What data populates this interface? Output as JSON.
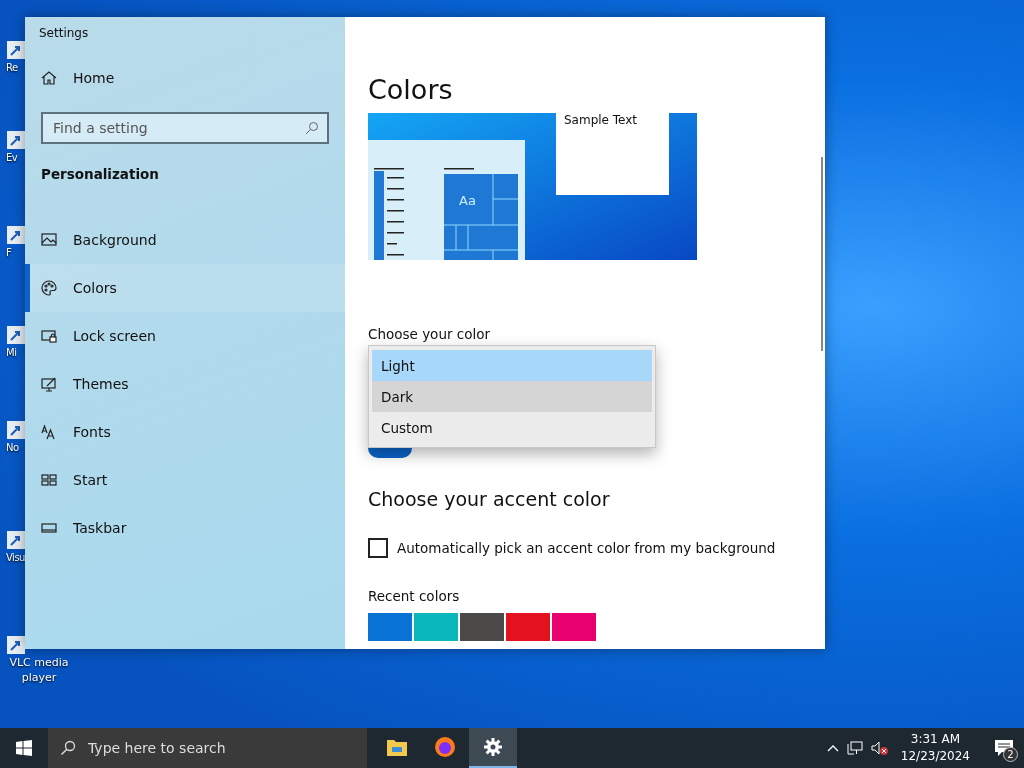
{
  "desktop_icons": [
    {
      "label": "Re"
    },
    {
      "label": "Ev"
    },
    {
      "label": "F"
    },
    {
      "label": "Mi"
    },
    {
      "label": "No"
    },
    {
      "label": "Visu"
    },
    {
      "label": "VLC media player"
    }
  ],
  "window": {
    "title": "Settings"
  },
  "sidebar": {
    "home": "Home",
    "search": {
      "placeholder": "Find a setting"
    },
    "section": "Personalization",
    "items": [
      {
        "label": "Background",
        "kind": "picture",
        "selected": false
      },
      {
        "label": "Colors",
        "kind": "palette",
        "selected": true
      },
      {
        "label": "Lock screen",
        "kind": "lock",
        "selected": false
      },
      {
        "label": "Themes",
        "kind": "brush",
        "selected": false
      },
      {
        "label": "Fonts",
        "kind": "fonts",
        "selected": false
      },
      {
        "label": "Start",
        "kind": "start",
        "selected": false
      },
      {
        "label": "Taskbar",
        "kind": "taskbar",
        "selected": false
      }
    ]
  },
  "content": {
    "title": "Colors",
    "preview": {
      "sample_text": "Sample Text",
      "tile_text": "Aa"
    },
    "choose_color": {
      "label": "Choose your color",
      "options": [
        {
          "label": "Light",
          "selected": true,
          "hovered": false
        },
        {
          "label": "Dark",
          "selected": false,
          "hovered": true
        },
        {
          "label": "Custom",
          "selected": false,
          "hovered": false
        }
      ]
    },
    "transparency_toggle": {
      "on": true
    },
    "accent_title": "Choose your accent color",
    "auto_pick": {
      "label": "Automatically pick an accent color from my background",
      "checked": false
    },
    "recent_colors": {
      "label": "Recent colors",
      "swatches": [
        {
          "color": "#0a74d6"
        },
        {
          "color": "#0ab8bc"
        },
        {
          "color": "#4c4a48"
        },
        {
          "color": "#e3121e"
        },
        {
          "color": "#e8006e"
        }
      ]
    }
  },
  "taskbar": {
    "search": {
      "placeholder": "Type here to search"
    },
    "apps": [
      {
        "kind": "folder",
        "active": false
      },
      {
        "kind": "browser",
        "active": false
      },
      {
        "kind": "gear",
        "active": true
      }
    ],
    "clock": {
      "time": "3:31 AM",
      "date": "12/23/2024"
    },
    "notifications": "2"
  }
}
